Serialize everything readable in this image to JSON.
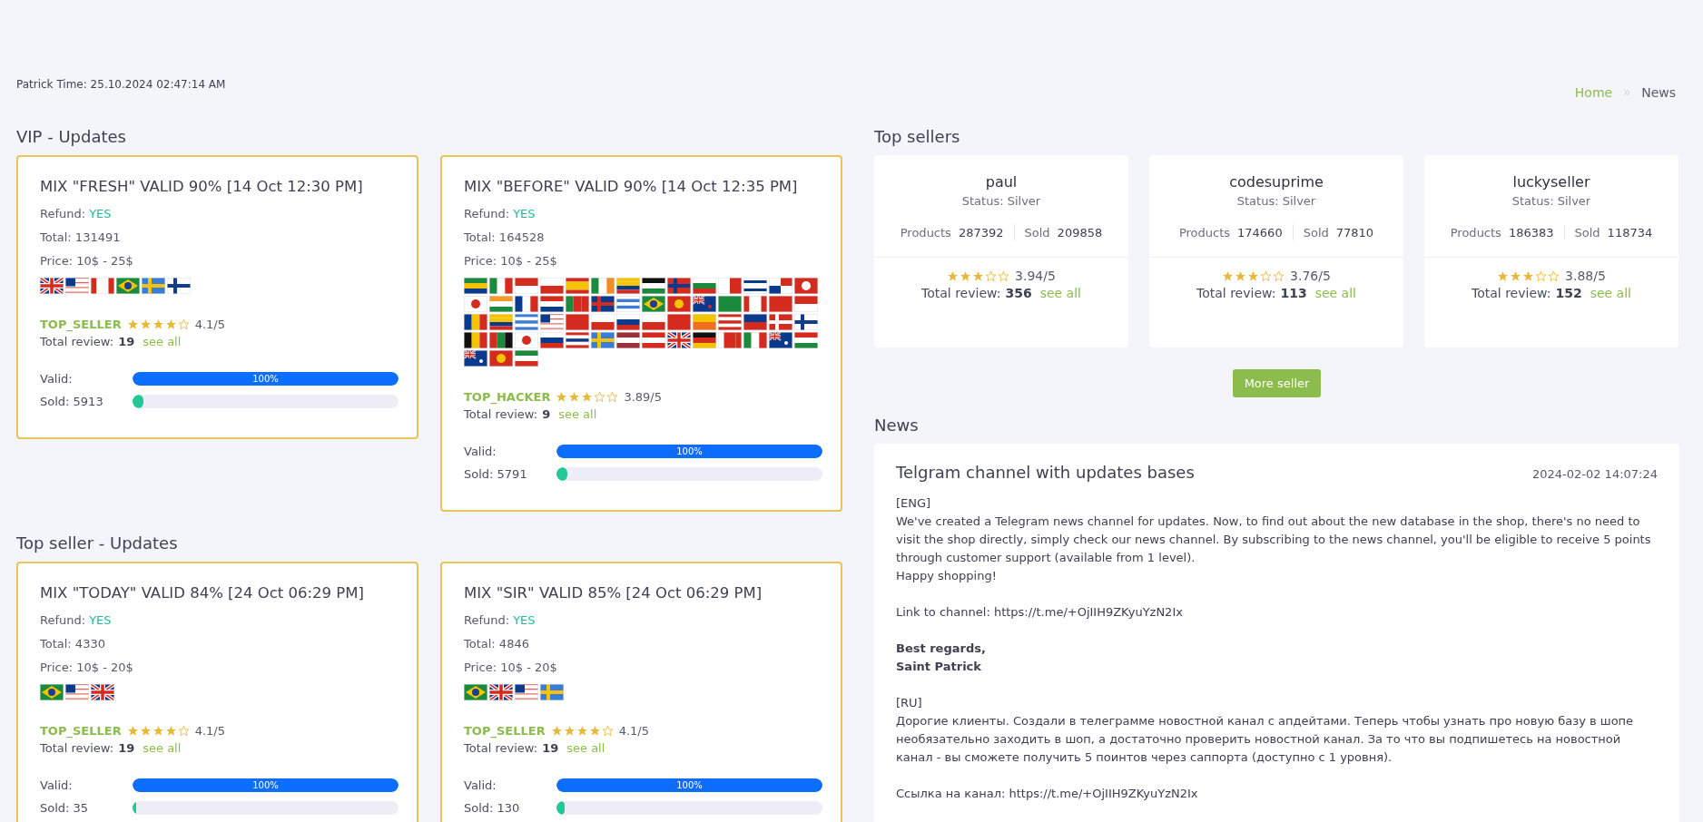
{
  "clock": "Patrick Time: 25.10.2024 02:47:14 AM",
  "breadcrumb": [
    {
      "label": "Home",
      "kind": "link"
    },
    {
      "label": "News",
      "kind": "current"
    }
  ],
  "sections": [
    {
      "title": "VIP - Updates",
      "cards": [
        {
          "title": "MIX \"FRESH\" VALID 90% [14 Oct 12:30 PM]",
          "refund_label": "Refund:",
          "refund": "YES",
          "total": "Total: 131491",
          "price": "Price: 10$ - 25$",
          "flags": [
            {
              "kind": "gb"
            },
            {
              "kind": "us"
            },
            {
              "kind": "ca"
            },
            {
              "kind": "br"
            },
            {
              "kind": "se"
            },
            {
              "kind": "fi"
            }
          ],
          "seller": "TOP_SELLER",
          "stars": 4,
          "rating": "4.1/5",
          "review_label": "Total review:",
          "reviews": "19",
          "see_all": "see all",
          "valid": {
            "label": "Valid:",
            "level": 1,
            "text": "100%"
          },
          "sold": {
            "label": "Sold: 5913",
            "level": 0.04
          }
        },
        {
          "title": "MIX \"BEFORE\" VALID 90% [14 Oct 12:35 PM]",
          "refund_label": "Refund:",
          "refund": "YES",
          "total": "Total: 164528",
          "price": "Price: 10$ - 25$",
          "flags": [
            {
              "kind": "za"
            },
            {
              "kind": "it"
            },
            {
              "kind": "sg"
            },
            {
              "kind": "pl"
            },
            {
              "kind": "es"
            },
            {
              "kind": "ie"
            },
            {
              "kind": "co"
            },
            {
              "kind": "jo"
            },
            {
              "kind": "no"
            },
            {
              "kind": "bg"
            },
            {
              "kind": "mt"
            },
            {
              "kind": "il"
            },
            {
              "kind": "pa"
            },
            {
              "kind": "ch"
            },
            {
              "kind": "kr"
            },
            {
              "kind": "in"
            },
            {
              "kind": "fr"
            },
            {
              "kind": "nl"
            },
            {
              "kind": "pt"
            },
            {
              "kind": "is"
            },
            {
              "kind": "uy"
            },
            {
              "kind": "br"
            },
            {
              "kind": "vn"
            },
            {
              "kind": "ky"
            },
            {
              "kind": "sa"
            },
            {
              "kind": "ca"
            },
            {
              "kind": "tt"
            },
            {
              "kind": "id"
            },
            {
              "kind": "ro"
            },
            {
              "kind": "ec"
            },
            {
              "kind": "gr"
            },
            {
              "kind": "us"
            },
            {
              "kind": "tr"
            },
            {
              "kind": "cz"
            },
            {
              "kind": "si"
            },
            {
              "kind": "cl"
            },
            {
              "kind": "cn"
            },
            {
              "kind": "bt"
            },
            {
              "kind": "my"
            },
            {
              "kind": "li"
            },
            {
              "kind": "dk"
            },
            {
              "kind": "fi"
            },
            {
              "kind": "be"
            },
            {
              "kind": "ae"
            },
            {
              "kind": "jp"
            },
            {
              "kind": "sk"
            },
            {
              "kind": "th"
            },
            {
              "kind": "se"
            },
            {
              "kind": "lv"
            },
            {
              "kind": "at"
            },
            {
              "kind": "gb"
            },
            {
              "kind": "de"
            },
            {
              "kind": "bh"
            },
            {
              "kind": "mx"
            },
            {
              "kind": "nz"
            },
            {
              "kind": "hu"
            },
            {
              "kind": "au"
            },
            {
              "kind": "hk"
            },
            {
              "kind": "kw"
            }
          ],
          "seller": "TOP_HACKER",
          "stars": 3,
          "rating": "3.89/5",
          "review_label": "Total review:",
          "reviews": "9",
          "see_all": "see all",
          "valid": {
            "label": "Valid:",
            "level": 1,
            "text": "100%"
          },
          "sold": {
            "label": "Sold: 5791",
            "level": 0.04
          }
        }
      ]
    },
    {
      "title": "Top seller - Updates",
      "cards": [
        {
          "title": "MIX \"TODAY\" VALID 84% [24 Oct 06:29 PM]",
          "refund_label": "Refund:",
          "refund": "YES",
          "total": "Total: 4330",
          "price": "Price: 10$ - 20$",
          "flags": [
            {
              "kind": "br"
            },
            {
              "kind": "us"
            },
            {
              "kind": "gb"
            }
          ],
          "seller": "TOP_SELLER",
          "stars": 4,
          "rating": "4.1/5",
          "review_label": "Total review:",
          "reviews": "19",
          "see_all": "see all",
          "valid": {
            "label": "Valid:",
            "level": 1,
            "text": "100%"
          },
          "sold": {
            "label": "Sold: 35",
            "level": 0.01
          }
        },
        {
          "title": "MIX \"SIR\" VALID 85% [24 Oct 06:29 PM]",
          "refund_label": "Refund:",
          "refund": "YES",
          "total": "Total: 4846",
          "price": "Price: 10$ - 20$",
          "flags": [
            {
              "kind": "br"
            },
            {
              "kind": "gb"
            },
            {
              "kind": "us"
            },
            {
              "kind": "se"
            }
          ],
          "seller": "TOP_SELLER",
          "stars": 4,
          "rating": "4.1/5",
          "review_label": "Total review:",
          "reviews": "19",
          "see_all": "see all",
          "valid": {
            "label": "Valid:",
            "level": 1,
            "text": "100%"
          },
          "sold": {
            "label": "Sold: 130",
            "level": 0.03
          }
        }
      ]
    }
  ],
  "top_sellers": {
    "title": "Top sellers",
    "sellers": [
      {
        "name": "paul",
        "status": "Status: Silver",
        "products_label": "Products",
        "products": "287392",
        "sold_label": "Sold",
        "sold": "209858",
        "stars": 3,
        "rating": "3.94/5",
        "review_label": "Total review:",
        "reviews": "356",
        "see_all": "see all"
      },
      {
        "name": "codesuprime",
        "status": "Status: Silver",
        "products_label": "Products",
        "products": "174660",
        "sold_label": "Sold",
        "sold": "77810",
        "stars": 3,
        "rating": "3.76/5",
        "review_label": "Total review:",
        "reviews": "113",
        "see_all": "see all"
      },
      {
        "name": "luckyseller",
        "status": "Status: Silver",
        "products_label": "Products",
        "products": "186383",
        "sold_label": "Sold",
        "sold": "118734",
        "stars": 3,
        "rating": "3.88/5",
        "review_label": "Total review:",
        "reviews": "152",
        "see_all": "see all"
      }
    ],
    "more_button": "More seller"
  },
  "news": {
    "title": "News",
    "posts": [
      {
        "title": "Telgram channel with updates bases",
        "date": "2024-02-02 14:07:24",
        "groups": [
          [
            {
              "text": "[ENG]",
              "bold": false
            },
            {
              "text": "We've created a Telegram news channel for updates. Now, to find out about the new database in the shop, there's no need to visit the shop directly, simply check our news channel. By subscribing to the news channel, you'll be eligible to receive 5 points through customer support (available from 1 level).",
              "bold": false
            },
            {
              "text": "Happy shopping!",
              "bold": false
            }
          ],
          [
            {
              "text": "Link to channel: https://t.me/+OjIIH9ZKyuYzN2Ix",
              "bold": false
            }
          ],
          [
            {
              "text": "Best regards,",
              "bold": true
            },
            {
              "text": "Saint Patrick",
              "bold": true
            }
          ],
          [
            {
              "text": "[RU]",
              "bold": false
            },
            {
              "text": "Дорогие клиенты. Создали в телеграмме новостной канал с апдейтами. Теперь чтобы узнать про новую базу в шопе необязательно заходить в шоп, а достаточно проверить новостной канал. За то что вы подпишетесь на новостной канал - вы сможете получить 5 поинтов через саппорта (доступно с 1 уровня).",
              "bold": false
            }
          ],
          [
            {
              "text": "Ссылка на канал: https://t.me/+OjIIH9ZKyuYzN2Ix",
              "bold": false
            }
          ]
        ]
      }
    ]
  }
}
